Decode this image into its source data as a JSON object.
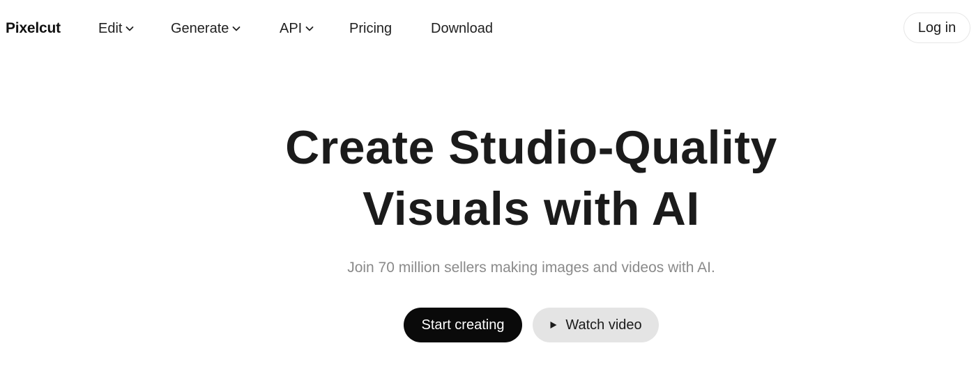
{
  "brand": {
    "logo_text": "Pixelcut"
  },
  "nav": {
    "items": [
      {
        "label": "Edit",
        "has_dropdown": true,
        "icon": "chevron-down-icon"
      },
      {
        "label": "Generate",
        "has_dropdown": true,
        "icon": "chevron-down-icon"
      },
      {
        "label": "API",
        "has_dropdown": true,
        "icon": "chevron-down-icon"
      },
      {
        "label": "Pricing",
        "has_dropdown": false
      },
      {
        "label": "Download",
        "has_dropdown": false
      }
    ],
    "login_label": "Log in"
  },
  "hero": {
    "title_line1": "Create Studio-Quality",
    "title_line2": "Visuals with AI",
    "subtitle": "Join 70 million sellers making images and videos with AI.",
    "primary_cta": "Start creating",
    "secondary_cta": "Watch video",
    "secondary_cta_icon": "play-icon"
  },
  "colors": {
    "primary_button_bg": "#0a0a0a",
    "secondary_button_bg": "#e4e4e4",
    "subtitle_text": "#8a8a8a",
    "title_text": "#1b1b1b"
  }
}
